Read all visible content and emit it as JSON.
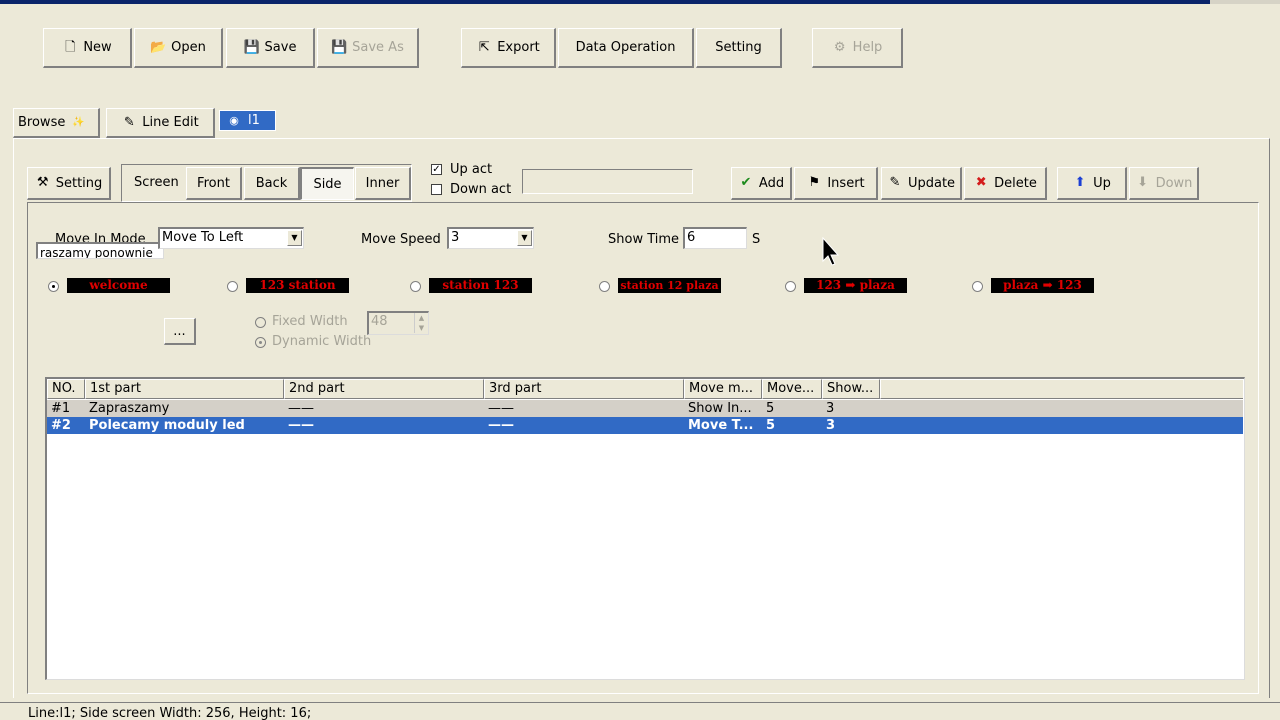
{
  "toolbar": {
    "new": "New",
    "open": "Open",
    "save": "Save",
    "save_as": "Save As",
    "export": "Export",
    "data_operation": "Data Operation",
    "setting": "Setting",
    "help": "Help"
  },
  "tabs": {
    "browse": "Browse",
    "line_edit": "Line Edit",
    "l1": "l1"
  },
  "panel": {
    "setting": "Setting",
    "screen_label": "Screen",
    "screens": [
      "Front",
      "Back",
      "Side",
      "Inner"
    ],
    "up_act": "Up act",
    "down_act": "Down act",
    "add": "Add",
    "insert": "Insert",
    "update": "Update",
    "delete": "Delete",
    "up": "Up",
    "down": "Down"
  },
  "form": {
    "move_in_mode_label": "Move In Mode",
    "move_in_mode_value": "Move To Left",
    "text_value": "raszamy ponownie",
    "move_speed_label": "Move Speed",
    "move_speed_value": "3",
    "show_time_label": "Show Time",
    "show_time_value": "6",
    "show_time_unit": "S",
    "browse_btn": "...",
    "fixed_width": "Fixed Width",
    "fixed_width_value": "48",
    "dynamic_width": "Dynamic Width"
  },
  "led_presets": [
    {
      "text": "welcome"
    },
    {
      "text": "123  station"
    },
    {
      "text": "station  123"
    },
    {
      "text": "station 12 plaza"
    },
    {
      "text": "123 ➡ plaza"
    },
    {
      "text": "plaza ➡ 123"
    }
  ],
  "table": {
    "columns": [
      "NO.",
      "1st part",
      "2nd part",
      "3rd part",
      "Move m...",
      "Move...",
      "Show..."
    ],
    "rows": [
      [
        "#1",
        "Zapraszamy",
        "——",
        "——",
        "Show In...",
        "5",
        "3"
      ],
      [
        "#2",
        "Polecamy moduly led",
        "——",
        "——",
        "Move T...",
        "5",
        "3"
      ]
    ]
  },
  "status": {
    "text": "Line:l1;  Side screen Width: 256, Height: 16;"
  },
  "colors": {
    "window_bg": "#ece9d8",
    "selection": "#316ac5",
    "led_red": "#e10000",
    "tab_active": "#316ac5"
  }
}
